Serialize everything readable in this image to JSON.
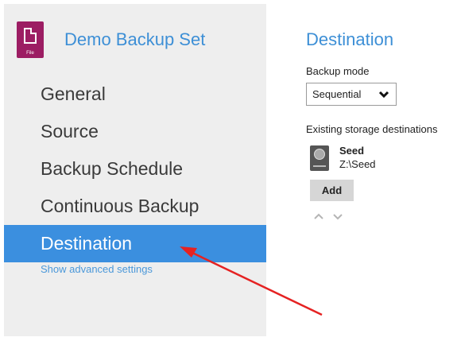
{
  "sidebar": {
    "set_icon_label": "File",
    "set_title": "Demo Backup Set",
    "items": [
      {
        "label": "General"
      },
      {
        "label": "Source"
      },
      {
        "label": "Backup Schedule"
      },
      {
        "label": "Continuous Backup"
      },
      {
        "label": "Destination",
        "active": true
      }
    ],
    "advanced_link": "Show advanced settings"
  },
  "main": {
    "title": "Destination",
    "backup_mode_label": "Backup mode",
    "backup_mode_value": "Sequential",
    "existing_label": "Existing storage destinations",
    "destinations": [
      {
        "name": "Seed",
        "path": "Z:\\Seed",
        "icon": "hard-drive-icon"
      }
    ],
    "add_button": "Add"
  },
  "colors": {
    "accent": "#3b8fdf",
    "title_blue": "#3d8fd6",
    "file_icon": "#9c1d63",
    "annotation_arrow": "#e52222"
  }
}
